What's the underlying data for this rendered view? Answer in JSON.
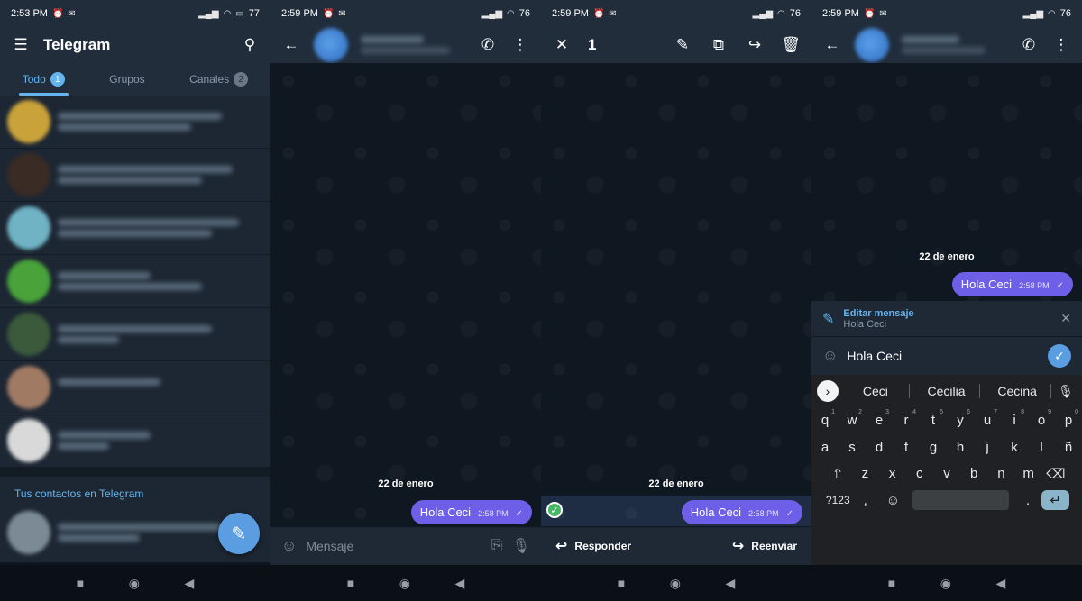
{
  "screens": [
    {
      "status": {
        "time": "2:53 PM",
        "battery": "77"
      },
      "appbar": {
        "title": "Telegram"
      },
      "tabs": [
        {
          "label": "Todo",
          "badge": "1"
        },
        {
          "label": "Grupos",
          "badge": ""
        },
        {
          "label": "Canales",
          "badge": "2"
        }
      ],
      "contacts_title": "Tus contactos en Telegram"
    },
    {
      "status": {
        "time": "2:59 PM",
        "battery": "76"
      },
      "date_chip": "22 de enero",
      "message": {
        "text": "Hola Ceci",
        "time": "2:58 PM"
      },
      "input_placeholder": "Mensaje"
    },
    {
      "status": {
        "time": "2:59 PM",
        "battery": "76"
      },
      "selection_count": "1",
      "date_chip": "22 de enero",
      "message": {
        "text": "Hola Ceci",
        "time": "2:58 PM"
      },
      "actions": {
        "reply": "Responder",
        "forward": "Reenviar"
      }
    },
    {
      "status": {
        "time": "2:59 PM",
        "battery": "76"
      },
      "date_chip": "22 de enero",
      "message": {
        "text": "Hola Ceci",
        "time": "2:58 PM"
      },
      "edit": {
        "title": "Editar mensaje",
        "original": "Hola Ceci",
        "value": "Hola Ceci"
      },
      "suggestions": [
        "Ceci",
        "Cecilia",
        "Cecina"
      ],
      "keyboard": {
        "row1": [
          "q",
          "w",
          "e",
          "r",
          "t",
          "y",
          "u",
          "i",
          "o",
          "p"
        ],
        "row1_hints": [
          "1",
          "2",
          "3",
          "4",
          "5",
          "6",
          "7",
          "8",
          "9",
          "0"
        ],
        "row2": [
          "a",
          "s",
          "d",
          "f",
          "g",
          "h",
          "j",
          "k",
          "l",
          "ñ"
        ],
        "row3": [
          "z",
          "x",
          "c",
          "v",
          "b",
          "n",
          "m"
        ],
        "symbols_key": "?123",
        "comma": ",",
        "period": "."
      }
    }
  ],
  "colors": {
    "bubble": "#6d5fe8",
    "accent": "#64b5ef",
    "bg": "#0e1621"
  }
}
